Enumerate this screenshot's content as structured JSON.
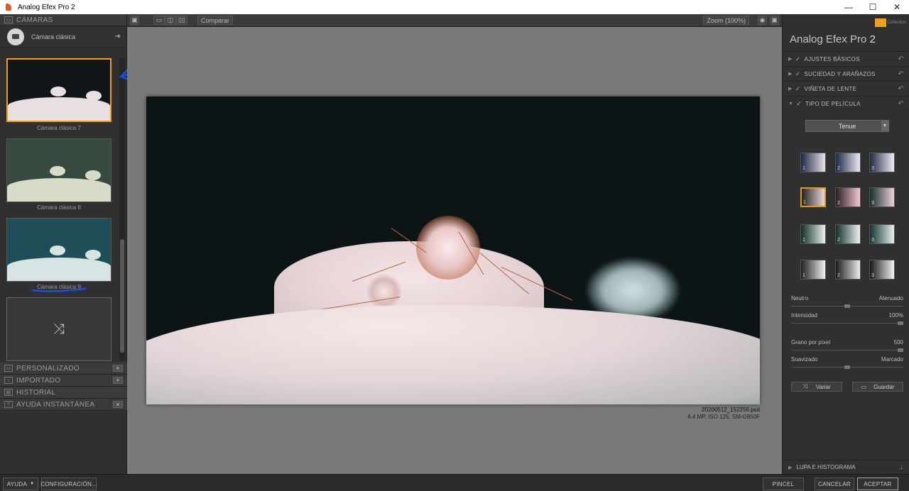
{
  "window": {
    "title": "Analog Efex Pro 2",
    "minimize": "—",
    "maximize": "☐",
    "close": "✕"
  },
  "left": {
    "cameras_header": "CÁMARAS",
    "camera_selector": "Cámara clásica",
    "thumbnails": [
      {
        "caption": "Cámara clásica 7",
        "bg": "#0f1518",
        "snow": "#e8e0e0"
      },
      {
        "caption": "Cámara clásica 8",
        "bg": "#364a40",
        "snow": "#d7dcc8"
      },
      {
        "caption": "Cámara clásica 9",
        "bg": "#1f4d58",
        "snow": "#d8e4e4"
      }
    ],
    "sections": [
      {
        "label": "PERSONALIZADO",
        "has_plus": true
      },
      {
        "label": "IMPORTADO",
        "has_plus": true
      },
      {
        "label": "HISTORIAL",
        "has_plus": false
      },
      {
        "label": "AYUDA INSTANTÁNEA",
        "has_plus": true
      }
    ]
  },
  "center": {
    "compare_label": "Comparar",
    "zoom_label": "Zoom (100%)",
    "file_name": "20200512_152256.psd",
    "file_meta": "6.4 MP, ISO 125, SM-G950F"
  },
  "right": {
    "brand": "Analog Efex Pro",
    "brand_version": "2",
    "nik_logo_text": "Collection",
    "sections": [
      {
        "label": "AJUSTES BÁSICOS",
        "open": false
      },
      {
        "label": "SUCIEDAD Y ARAÑAZOS",
        "open": false
      },
      {
        "label": "VIÑETA DE LENTE",
        "open": false
      },
      {
        "label": "TIPO DE PELÍCULA",
        "open": true
      }
    ],
    "film_dropdown": "Tenue",
    "swatch_rows": [
      [
        {
          "num": "1",
          "from": "#1d2a48",
          "to": "#ece0ea"
        },
        {
          "num": "2",
          "from": "#1c2a4a",
          "to": "#efe8f0"
        },
        {
          "num": "3",
          "from": "#222a44",
          "to": "#f0eaf3"
        }
      ],
      [
        {
          "num": "1",
          "from": "#222222",
          "to": "#ead8d8",
          "selected": true
        },
        {
          "num": "2",
          "from": "#2a1e22",
          "to": "#f5c9d4"
        },
        {
          "num": "3",
          "from": "#14302a",
          "to": "#f0d0dc"
        }
      ],
      [
        {
          "num": "1",
          "from": "#123028",
          "to": "#e8f0ee"
        },
        {
          "num": "2",
          "from": "#10302a",
          "to": "#eef4f2"
        },
        {
          "num": "3",
          "from": "#143430",
          "to": "#e6f0ee"
        }
      ],
      [
        {
          "num": "1",
          "from": "#202020",
          "to": "#f2f2f2"
        },
        {
          "num": "2",
          "from": "#1c1c1c",
          "to": "#ededed"
        },
        {
          "num": "3",
          "from": "#181818",
          "to": "#f4f4f4"
        }
      ]
    ],
    "sliders": [
      {
        "left": "Neutro",
        "right": "Atenuado",
        "value": 0.5
      },
      {
        "left": "Intensidad",
        "right": "100%",
        "value": 1.0
      },
      {
        "left": "Grano por píxel",
        "right": "500",
        "value": 1.0
      },
      {
        "left": "Suavizado",
        "right": "Marcado",
        "value": 0.5
      }
    ],
    "variar_label": "Variar",
    "guardar_label": "Guardar",
    "loupe_label": "LUPA E HISTOGRAMA"
  },
  "bottom": {
    "help": "AYUDA",
    "config": "CONFIGURACIÓN...",
    "brush": "PINCEL",
    "cancel": "CANCELAR",
    "accept": "ACEPTAR"
  },
  "colors": {
    "selection_accent": "#f0a020",
    "annotation_blue": "#1a4fd8"
  }
}
